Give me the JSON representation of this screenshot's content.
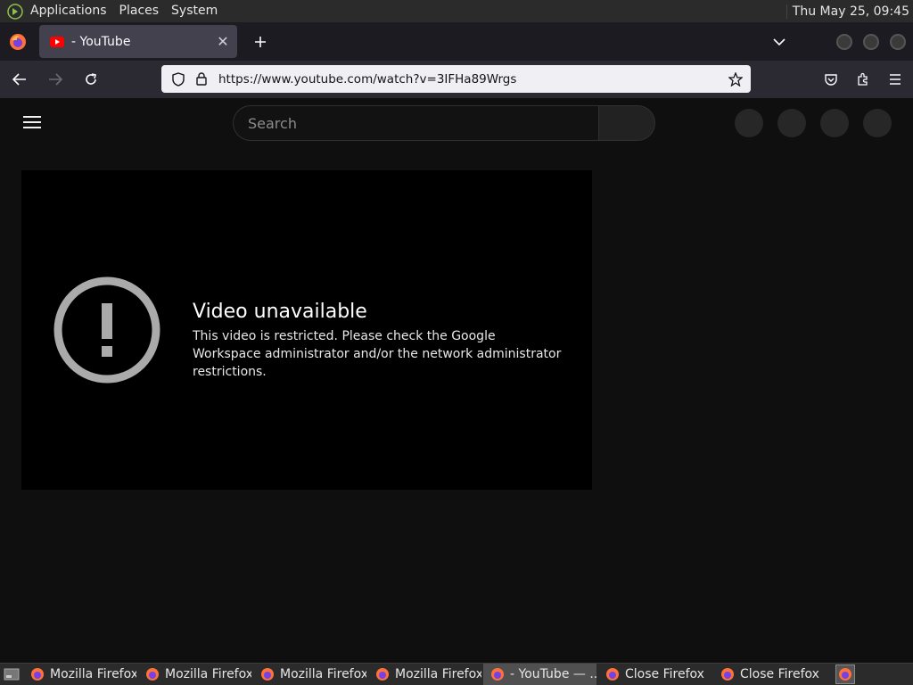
{
  "top_panel": {
    "menus": [
      "Applications",
      "Places",
      "System"
    ],
    "clock": "Thu May 25, 09:45"
  },
  "browser": {
    "tab": {
      "title": "- YouTube"
    },
    "url": "https://www.youtube.com/watch?v=3IFHa89Wrgs"
  },
  "youtube": {
    "search_placeholder": "Search",
    "error_title": "Video unavailable",
    "error_message": "This video is restricted. Please check the Google Workspace administrator and/or the network administrator restrictions."
  },
  "taskbar": {
    "items": [
      {
        "label": "Mozilla Firefox",
        "active": false
      },
      {
        "label": "Mozilla Firefox",
        "active": false
      },
      {
        "label": "Mozilla Firefox",
        "active": false
      },
      {
        "label": "Mozilla Firefox",
        "active": false
      },
      {
        "label": "- YouTube — ...",
        "active": true
      },
      {
        "label": "Close Firefox",
        "active": false
      },
      {
        "label": "Close Firefox",
        "active": false
      }
    ]
  },
  "colors": {
    "youtube_red": "#ff0000",
    "page_bg": "#0f0f0f",
    "firefox_orange": "#ff7139"
  }
}
